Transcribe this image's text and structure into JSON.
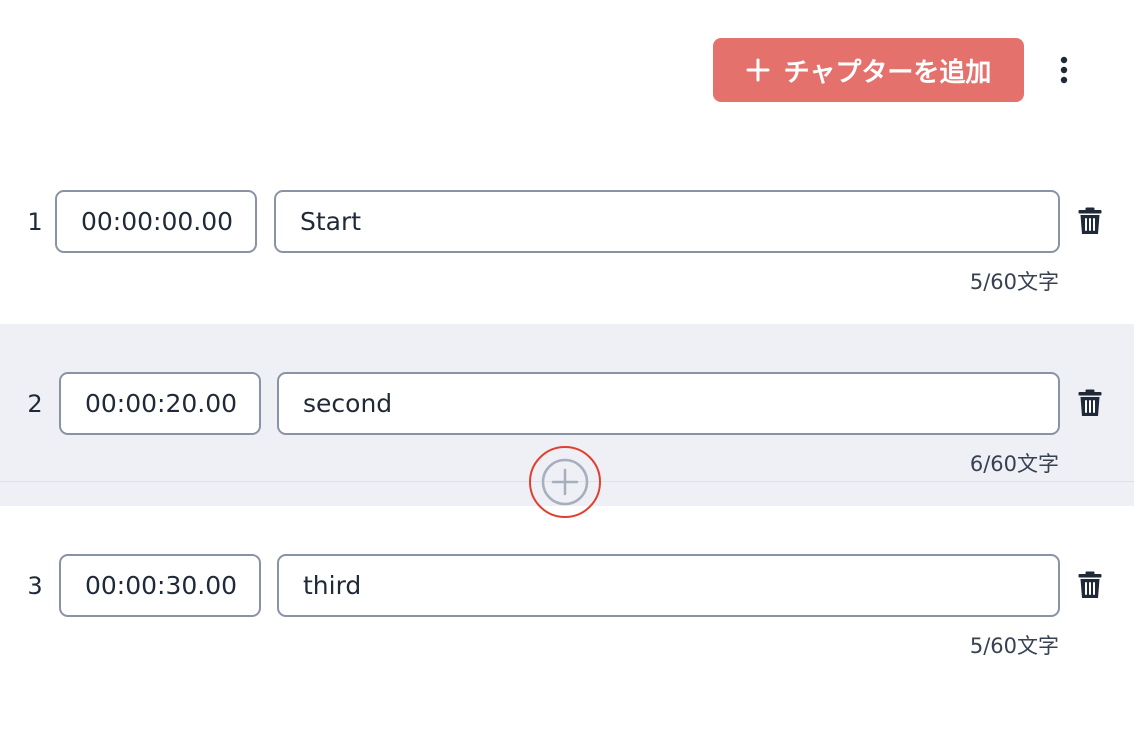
{
  "toolbar": {
    "add_chapter_label": "チャプターを追加",
    "plus_icon": "plus-icon",
    "more_icon": "vertical-dots-icon",
    "accent_color": "#e5716d"
  },
  "chapters": [
    {
      "index": "1",
      "time": "00:00:00.00",
      "title": "Start",
      "char_count": "5/60文字"
    },
    {
      "index": "2",
      "time": "00:00:20.00",
      "title": "second",
      "char_count": "6/60文字"
    },
    {
      "index": "3",
      "time": "00:00:30.00",
      "title": "third",
      "char_count": "5/60文字"
    }
  ],
  "delete_icon": "trash-icon",
  "insert_icon": "circle-plus-icon",
  "highlight_color": "#e0402f",
  "active_row_bg": "#eef0f5"
}
